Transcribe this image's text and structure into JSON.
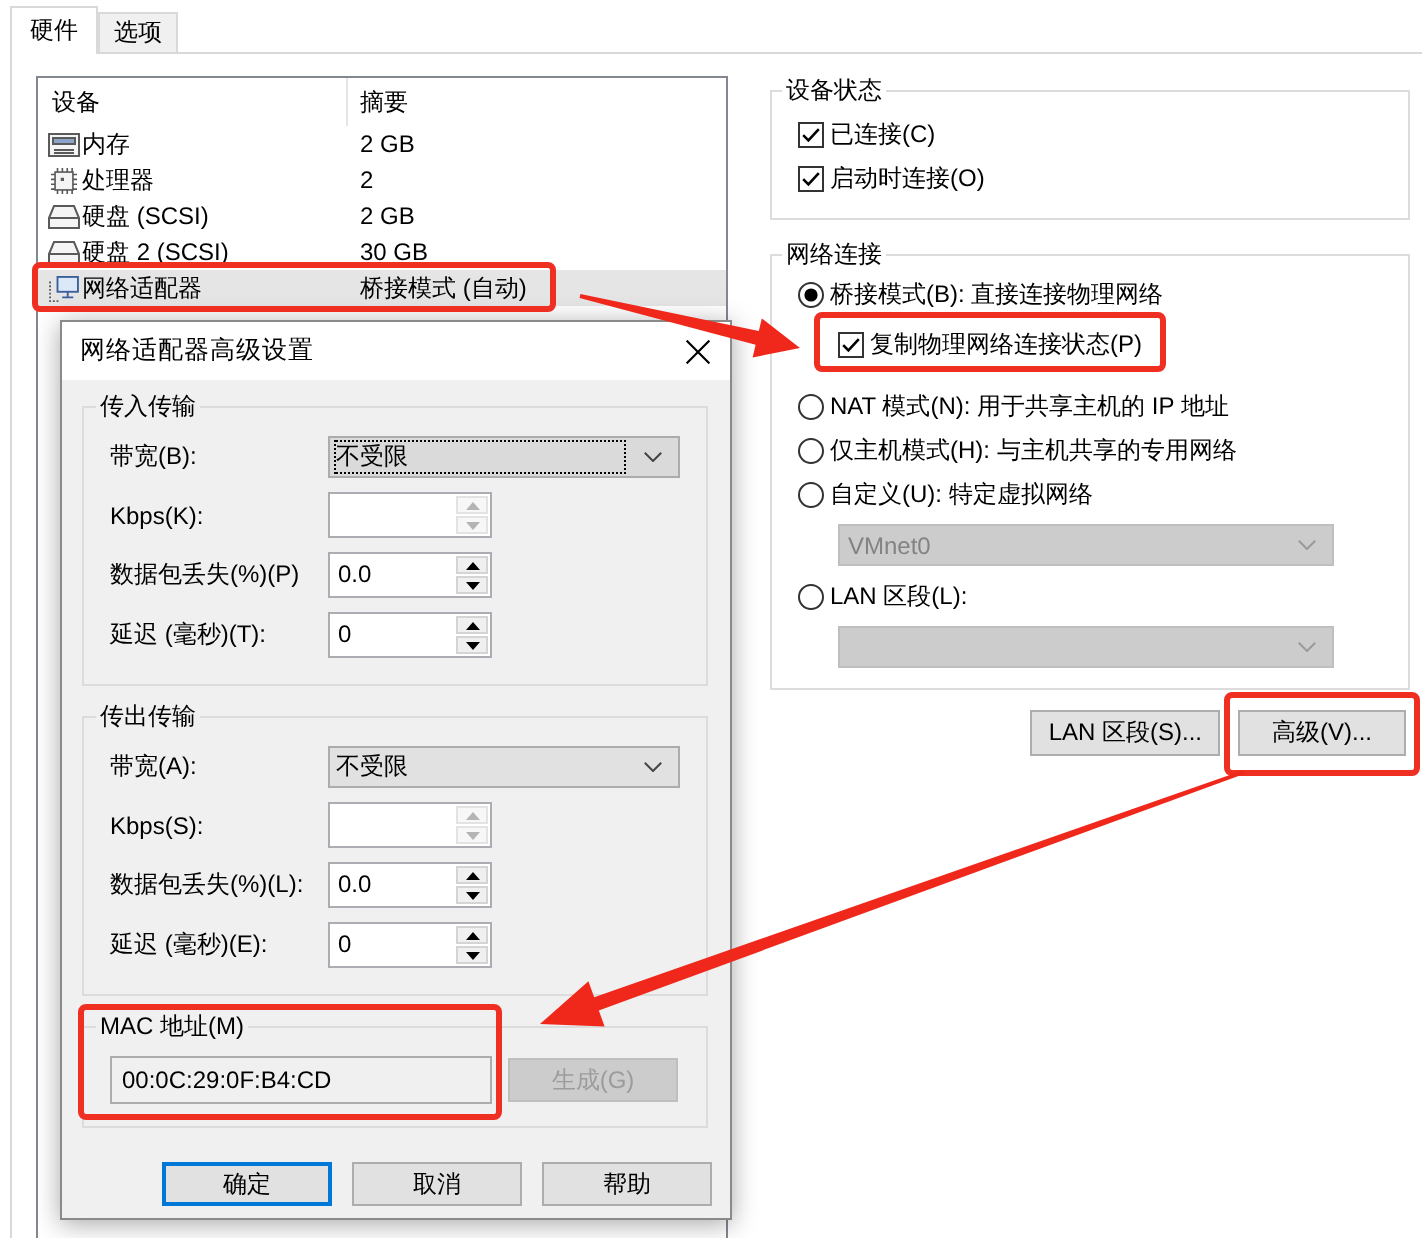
{
  "tabs": [
    {
      "label": "硬件",
      "selected": true
    },
    {
      "label": "选项",
      "selected": false
    }
  ],
  "device_list": {
    "columns": [
      "设备",
      "摘要"
    ],
    "rows": [
      {
        "kind": "memory",
        "device": "内存",
        "summary": "2 GB",
        "selected": false,
        "highlighted": false
      },
      {
        "kind": "processor",
        "device": "处理器",
        "summary": "2",
        "selected": false,
        "highlighted": false
      },
      {
        "kind": "disk",
        "device": "硬盘 (SCSI)",
        "summary": "2 GB",
        "selected": false,
        "highlighted": false
      },
      {
        "kind": "disk",
        "device": "硬盘 2 (SCSI)",
        "summary": "30 GB",
        "selected": false,
        "highlighted": false
      },
      {
        "kind": "network",
        "device": "网络适配器",
        "summary": "桥接模式 (自动)",
        "selected": true,
        "highlighted": true
      }
    ]
  },
  "device_status": {
    "title": "设备状态",
    "options": [
      {
        "label": "已连接(C)",
        "checked": true
      },
      {
        "label": "启动时连接(O)",
        "checked": true
      }
    ]
  },
  "network_connection": {
    "title": "网络连接",
    "options": [
      {
        "kind": "radio",
        "label": "桥接模式(B): 直接连接物理网络",
        "selected": true,
        "highlighted": false
      },
      {
        "kind": "checkbox",
        "label": "复制物理网络连接状态(P)",
        "checked": true,
        "highlighted": true
      },
      {
        "kind": "radio",
        "label": "NAT 模式(N): 用于共享主机的 IP 地址",
        "selected": false,
        "highlighted": false
      },
      {
        "kind": "radio",
        "label": "仅主机模式(H): 与主机共享的专用网络",
        "selected": false,
        "highlighted": false
      },
      {
        "kind": "radio",
        "label": "自定义(U): 特定虚拟网络",
        "selected": false,
        "highlighted": false
      },
      {
        "kind": "dropdown",
        "value": "VMnet0",
        "disabled": true,
        "highlighted": false
      },
      {
        "kind": "radio",
        "label": "LAN 区段(L):",
        "selected": false,
        "highlighted": false
      },
      {
        "kind": "dropdown",
        "disabled": true,
        "highlighted": false
      }
    ]
  },
  "buttons": [
    {
      "label": "LAN 区段(S)...",
      "highlighted": false
    },
    {
      "label": "高级(V)...",
      "highlighted": true
    }
  ],
  "dialog": {
    "title": "网络适配器高级设置",
    "groups": [
      {
        "title": "传入传输",
        "fields": [
          {
            "kind": "dropdown",
            "label": "带宽(B):",
            "value": "不受限",
            "focused": true
          },
          {
            "kind": "spinner",
            "label": "Kbps(K):",
            "disabled": true
          },
          {
            "kind": "spinner",
            "label": "数据包丢失(%)(P)",
            "value": "0.0",
            "disabled": false
          },
          {
            "kind": "spinner",
            "label": "延迟 (毫秒)(T):",
            "value": "0",
            "disabled": false
          }
        ]
      },
      {
        "title": "传出传输",
        "fields": [
          {
            "kind": "dropdown",
            "label": "带宽(A):",
            "value": "不受限",
            "focused": false
          },
          {
            "kind": "spinner",
            "label": "Kbps(S):",
            "disabled": true
          },
          {
            "kind": "spinner",
            "label": "数据包丢失(%)(L):",
            "value": "0.0",
            "disabled": false
          },
          {
            "kind": "spinner",
            "label": "延迟 (毫秒)(E):",
            "value": "0",
            "disabled": false
          }
        ]
      }
    ],
    "mac": {
      "title": "MAC 地址(M)",
      "value": "00:0C:29:0F:B4:CD",
      "highlighted": true,
      "button": {
        "label": "生成(G)",
        "disabled": true
      }
    },
    "buttons": [
      {
        "label": "确定",
        "default": true
      },
      {
        "label": "取消",
        "default": false
      },
      {
        "label": "帮助",
        "default": false
      }
    ]
  }
}
